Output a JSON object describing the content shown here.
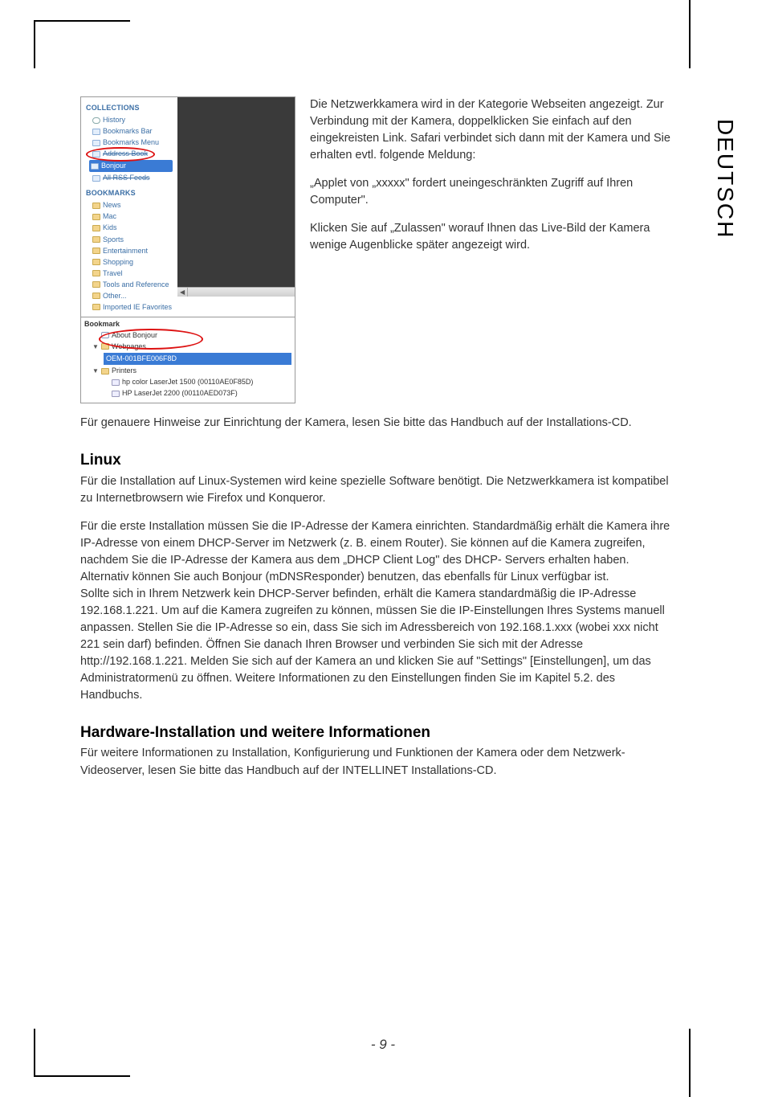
{
  "side_tab": "DEUTSCH",
  "figure": {
    "collections_header": "COLLECTIONS",
    "collections": [
      {
        "label": "History",
        "icon": "hist"
      },
      {
        "label": "Bookmarks Bar",
        "icon": "blue"
      },
      {
        "label": "Bookmarks Menu",
        "icon": "blue"
      },
      {
        "label": "Address Book",
        "icon": "blue",
        "struck": true
      },
      {
        "label": "Bonjour",
        "icon": "blue",
        "selected": true
      },
      {
        "label": "All RSS Feeds",
        "icon": "blue",
        "struck": true
      }
    ],
    "bookmarks_header": "BOOKMARKS",
    "bookmarks": [
      "News",
      "Mac",
      "Kids",
      "Sports",
      "Entertainment",
      "Shopping",
      "Travel",
      "Tools and Reference",
      "Other...",
      "Imported IE Favorites"
    ],
    "bookmark_panel_header": "Bookmark",
    "tree": {
      "about": "About Bonjour",
      "webpages": "Webpages",
      "oem": "OEM-001BFE006F8D",
      "printers": "Printers",
      "p1": "hp color LaserJet 1500 (00110AE0F85D)",
      "p2": "HP LaserJet 2200 (00110AED073F)"
    }
  },
  "body": {
    "p1": "Die Netzwerkkamera wird in der Kategorie Webseiten angezeigt. Zur Verbindung mit der Kamera, doppelklicken Sie einfach auf den eingekreisten Link. Safari verbindet sich dann mit der Kamera und Sie erhalten evtl. folgende Meldung:",
    "p2": "„Applet von „xxxxx\" fordert uneingeschränkten Zugriff auf Ihren Computer\".",
    "p3": "Klicken Sie auf „Zulassen\" worauf Ihnen das Live-Bild der Kamera wenige Augenblicke später angezeigt wird.",
    "p4": "Für genauere Hinweise zur Einrichtung der Kamera, lesen Sie bitte das Handbuch auf der Installations-CD.",
    "h_linux": "Linux",
    "p5": "Für die Installation auf Linux-Systemen wird keine spezielle Software benötigt. Die Netzwerkkamera ist kompatibel zu Internetbrowsern wie Firefox und Konqueror.",
    "p6": "Für die erste Installation müssen Sie die IP-Adresse der Kamera einrichten. Standardmäßig erhält die Kamera ihre IP-Adresse von einem DHCP-Server im Netzwerk (z. B. einem Router). Sie können auf die Kamera zugreifen, nachdem Sie die IP-Adresse der Kamera aus dem „DHCP Client Log\" des DHCP- Servers erhalten haben. Alternativ können Sie auch Bonjour (mDNSResponder) benutzen, das ebenfalls für Linux verfügbar ist.",
    "p7": "Sollte sich in Ihrem Netzwerk kein DHCP-Server befinden, erhält die Kamera standardmäßig die IP-Adresse 192.168.1.221. Um auf die Kamera zugreifen zu können, müssen Sie die IP-Einstellungen Ihres Systems manuell anpassen. Stellen Sie die IP-Adresse so ein, dass Sie sich im Adressbereich von 192.168.1.xxx (wobei xxx nicht 221 sein darf) befinden. Öffnen Sie danach Ihren Browser und verbinden Sie sich mit der Adresse http://192.168.1.221. Melden Sie sich auf der Kamera an und klicken Sie auf \"Settings\" [Einstellungen], um das Administratormenü zu öffnen. Weitere Informationen zu den Einstellungen finden Sie im Kapitel 5.2. des Handbuchs.",
    "h_hw": "Hardware-Installation und weitere Informationen",
    "p8": "Für weitere Informationen zu Installation, Konfigurierung und Funktionen der Kamera oder dem Netzwerk-Videoserver, lesen Sie bitte das Handbuch auf der INTELLINET Installations-CD."
  },
  "page_number": "- 9 -"
}
